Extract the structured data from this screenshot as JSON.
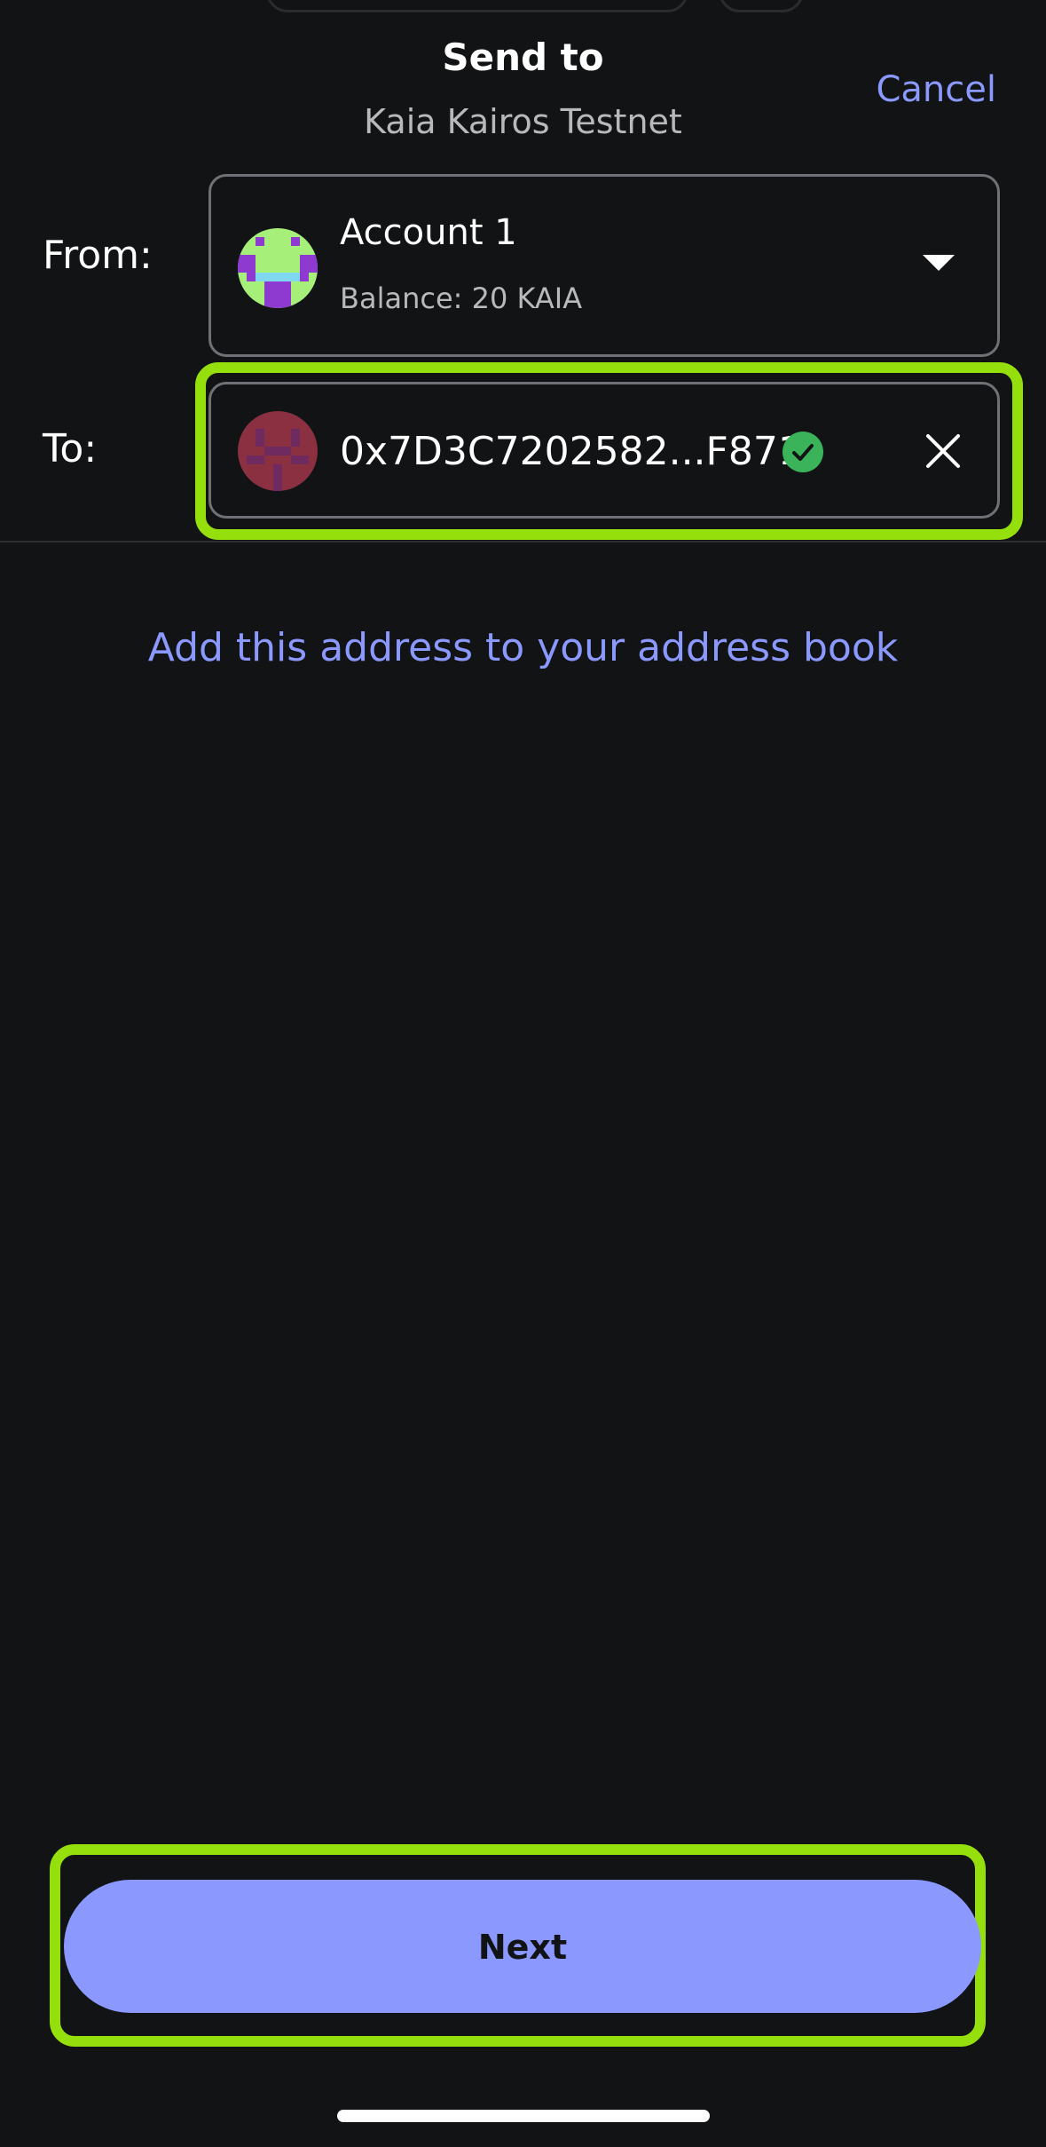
{
  "header": {
    "title": "Send to",
    "subtitle": "Kaia Kairos Testnet",
    "cancel_label": "Cancel"
  },
  "from": {
    "label": "From:",
    "account_name": "Account 1",
    "balance": "Balance: 20 KAIA",
    "avatar_icon": "identicon-green-purple"
  },
  "to": {
    "label": "To:",
    "address": "0x7D3C7202582...F871",
    "avatar_icon": "identicon-red",
    "verified_icon": "check-circle-icon",
    "clear_icon": "close-icon"
  },
  "address_book_link": "Add this address to your address book",
  "next_label": "Next",
  "colors": {
    "background": "#121314",
    "accent": "#8b99ff",
    "highlight": "#94df0c",
    "verified": "#3bb35b"
  }
}
